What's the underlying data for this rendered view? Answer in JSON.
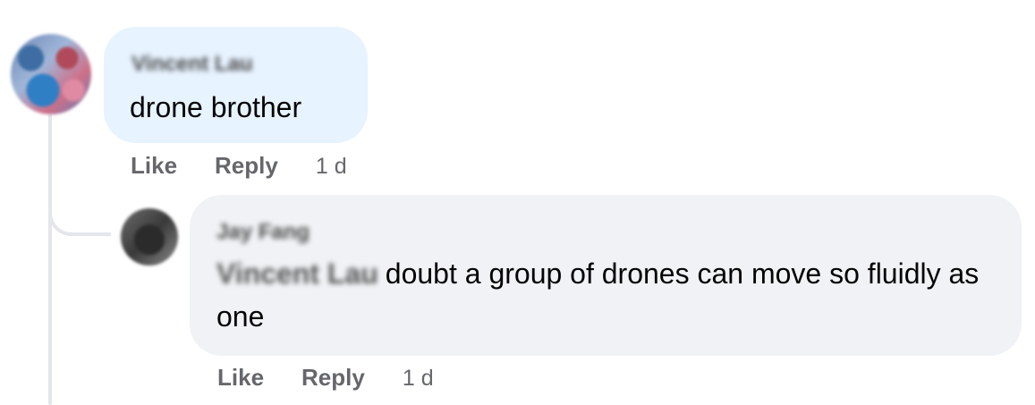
{
  "comments": [
    {
      "author": "Vincent Lau",
      "text": "drone brother",
      "like_label": "Like",
      "reply_label": "Reply",
      "time": "1 d"
    },
    {
      "author": "Jay Fang",
      "mention": "Vincent Lau",
      "text": "doubt a group of drones can move so fluidly as one",
      "like_label": "Like",
      "reply_label": "Reply",
      "time": "1 d"
    }
  ],
  "colors": {
    "top_bubble": "#e7f3ff",
    "reply_bubble": "#f0f2f5",
    "thread_line": "#e4e6eb",
    "secondary_text": "#65676b"
  }
}
